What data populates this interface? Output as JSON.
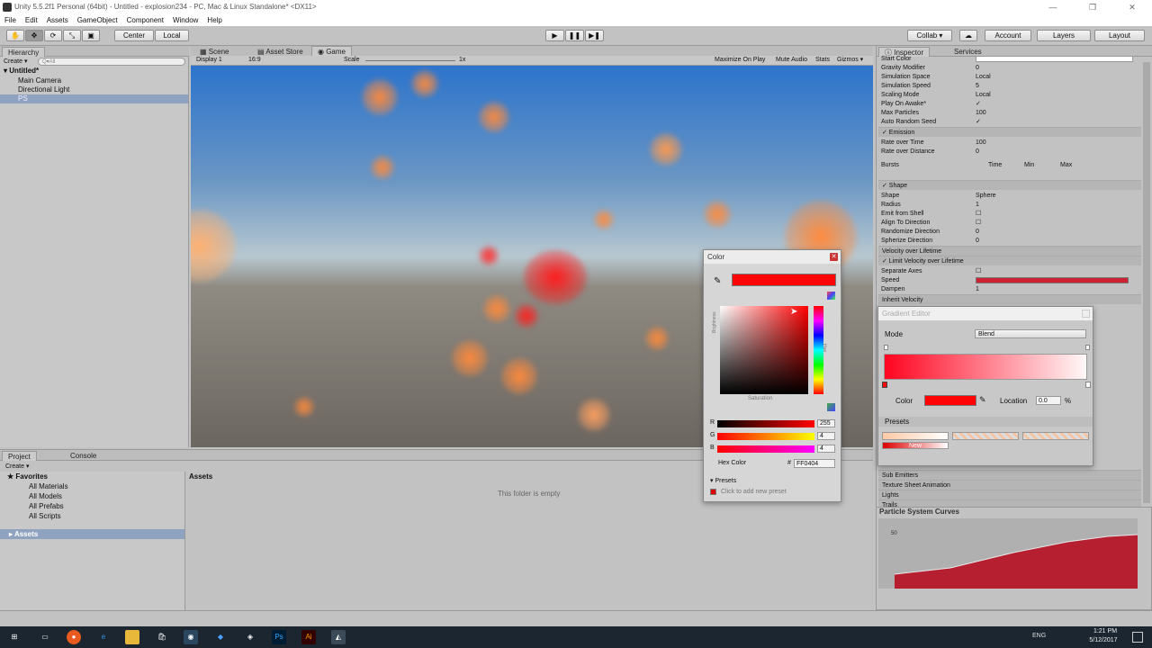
{
  "window": {
    "title": "Unity 5.5.2f1 Personal (64bit) - Untitled - explosion234 - PC, Mac & Linux Standalone* <DX11>"
  },
  "menu": [
    "File",
    "Edit",
    "Assets",
    "GameObject",
    "Component",
    "Window",
    "Help"
  ],
  "toolbar": {
    "center": "Center",
    "local": "Local",
    "collab": "Collab ▾",
    "account": "Account",
    "layers": "Layers",
    "layout": "Layout"
  },
  "hierarchy": {
    "tab": "Hierarchy",
    "create": "Create ▾",
    "search_placeholder": "Q▾All",
    "scene": "Untitled*",
    "items": [
      "Main Camera",
      "Directional Light",
      "PS"
    ]
  },
  "scene_tabs": [
    "Scene",
    "Asset Store",
    "Game"
  ],
  "game_bar": {
    "display": "Display 1",
    "aspect": "16:9",
    "scale_label": "Scale",
    "scale_value": "1x",
    "max_on_play": "Maximize On Play",
    "mute": "Mute Audio",
    "stats": "Stats",
    "gizmos": "Gizmos ▾"
  },
  "project": {
    "tab_project": "Project",
    "tab_console": "Console",
    "create": "Create ▾",
    "favorites": "Favorites",
    "fav_items": [
      "All Materials",
      "All Models",
      "All Prefabs",
      "All Scripts"
    ],
    "assets_root": "Assets",
    "assets_header": "Assets",
    "empty": "This folder is empty"
  },
  "inspector": {
    "tab_inspector": "Inspector",
    "tab_services": "Services",
    "rows1": [
      [
        "Start Color",
        ""
      ],
      [
        "Gravity Modifier",
        "0"
      ],
      [
        "Simulation Space",
        "Local"
      ],
      [
        "Simulation Speed",
        "5"
      ],
      [
        "Scaling Mode",
        "Local"
      ],
      [
        "Play On Awake*",
        "✓"
      ],
      [
        "Max Particles",
        "100"
      ],
      [
        "Auto Random Seed",
        "✓"
      ]
    ],
    "emission": "✓ Emission",
    "rows2": [
      [
        "Rate over Time",
        "100"
      ],
      [
        "Rate over Distance",
        "0"
      ]
    ],
    "bursts": "Bursts",
    "bursts_cols": [
      "Time",
      "Min",
      "Max"
    ],
    "shape": "✓ Shape",
    "rows3": [
      [
        "Shape",
        "Sphere"
      ],
      [
        "Radius",
        "1"
      ],
      [
        "Emit from Shell",
        ""
      ],
      [
        "Align To Direction",
        ""
      ],
      [
        "Randomize Direction",
        "0"
      ],
      [
        "Spherize Direction",
        "0"
      ]
    ],
    "vel": "Velocity over Lifetime",
    "limit": "✓ Limit Velocity over Lifetime",
    "rows4": [
      [
        "Separate Axes",
        ""
      ],
      [
        "Speed",
        ""
      ],
      [
        "Dampen",
        "1"
      ]
    ],
    "inherit": "Inherit Velocity",
    "lower": [
      "Sub Emitters",
      "Texture Sheet Animation",
      "Lights",
      "Trails"
    ],
    "curves_title": "Particle System Curves",
    "curves_max": "50"
  },
  "color_dialog": {
    "title": "Color",
    "brightness": "Brightness",
    "saturation": "Saturation",
    "hue": "Hue",
    "r_label": "R",
    "g_label": "G",
    "b_label": "B",
    "r": "255",
    "g": "4",
    "b": "4",
    "hex_label": "Hex Color",
    "hex_hash": "#",
    "hex": "FF0404",
    "presets": "▾ Presets",
    "add_preset": "Click to add new preset",
    "color": "#ff0404"
  },
  "gradient_editor": {
    "title": "Gradient Editor",
    "mode_label": "Mode",
    "mode_value": "Blend",
    "color_label": "Color",
    "location_label": "Location",
    "location_value": "0.0",
    "percent": "%",
    "presets": "Presets",
    "new_label": "New"
  },
  "taskbar": {
    "time": "1:21 PM",
    "date": "5/12/2017",
    "lang": "ENG"
  }
}
